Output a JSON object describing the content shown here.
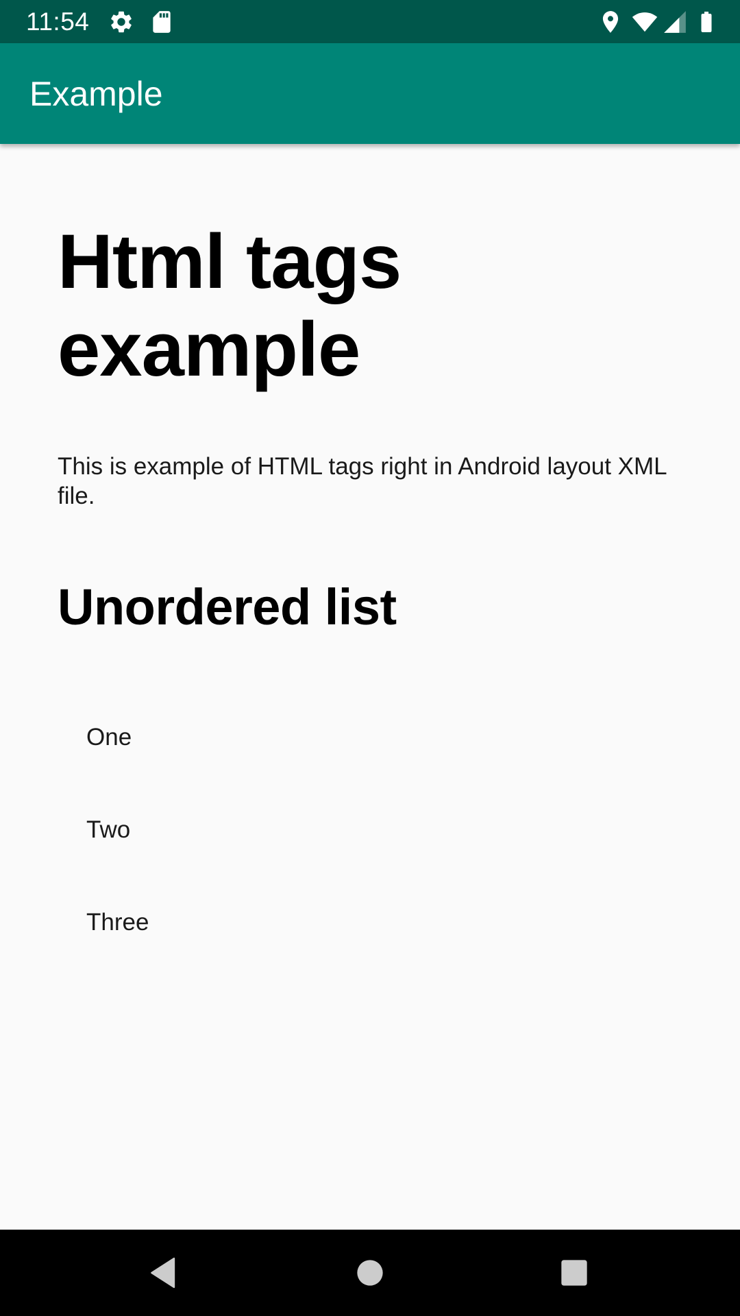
{
  "status_bar": {
    "time": "11:54",
    "background": "#00574b",
    "icons": [
      "settings-icon",
      "sd-card-icon",
      "location-icon",
      "wifi-icon",
      "signal-icon",
      "battery-icon"
    ]
  },
  "app_bar": {
    "title": "Example",
    "background": "#008577"
  },
  "content": {
    "heading": "Html tags example",
    "paragraph": "This is example of HTML tags right in Android layout XML file.",
    "subheading": "Unordered list",
    "list_items": [
      "One",
      "Two",
      "Three"
    ]
  },
  "nav_bar": {
    "background": "#000000",
    "buttons": [
      "back-icon",
      "home-icon",
      "recents-icon"
    ]
  }
}
